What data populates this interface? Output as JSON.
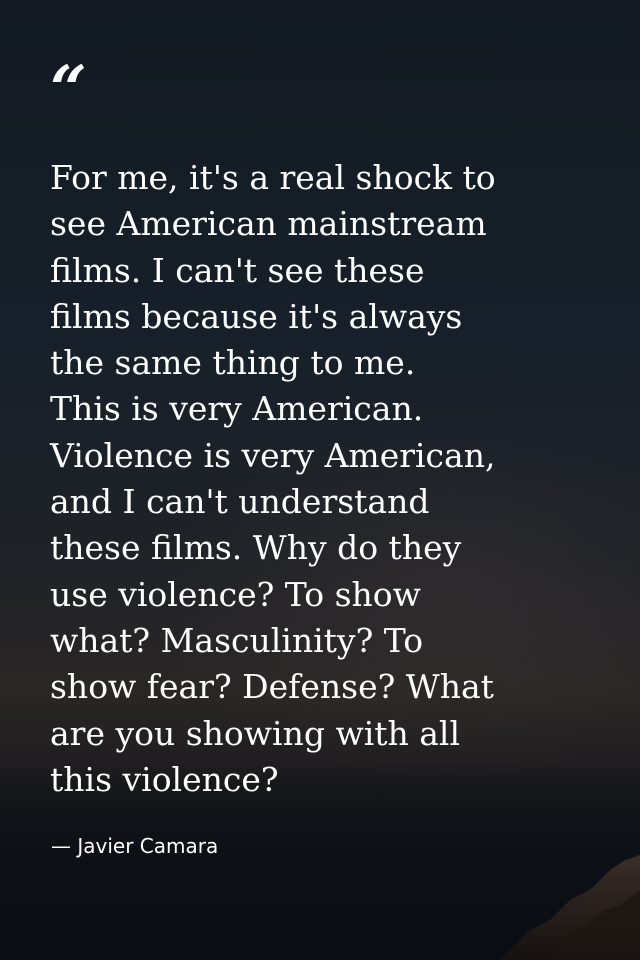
{
  "quote": {
    "mark": "“",
    "lines": [
      "For me, it's a real shock to",
      "see American mainstream",
      "films. I can't see these",
      "films because it's always",
      "the same thing to me.",
      "This is very American.",
      "Violence is very American,",
      "and I can't understand",
      "these films. Why do they",
      "use violence? To show",
      "what? Masculinity? To",
      "show fear? Defense? What",
      "are you showing with all",
      "this violence?"
    ],
    "author": "— Javier Camara"
  },
  "colors": {
    "text": "#ffffff",
    "background": "#131a22"
  }
}
